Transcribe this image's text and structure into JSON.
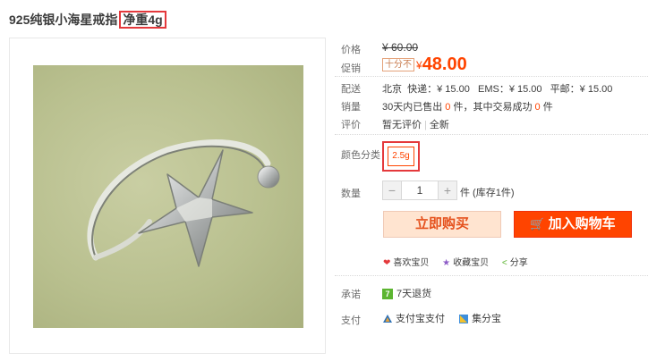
{
  "product": {
    "title": "925纯银小海星戒指",
    "title_highlight": "净重4g"
  },
  "price": {
    "label": "价格",
    "original": "¥ 60.00"
  },
  "promo": {
    "label": "促销",
    "tag": "十分不",
    "yen": "¥",
    "value": "48.00"
  },
  "delivery": {
    "label": "配送",
    "text": "北京  快递：¥ 15.00   EMS：¥ 15.00   平邮：¥ 15.00"
  },
  "sales": {
    "label": "销量",
    "text_a": "30天内已售出 ",
    "count_a": "0",
    "text_b": " 件，其中交易成功 ",
    "count_b": "0",
    "text_c": " 件"
  },
  "review": {
    "label": "评价",
    "none": "暂无评价",
    "divider": "|",
    "all": "全新"
  },
  "color": {
    "label": "颜色分类",
    "option": "2.5g"
  },
  "quantity": {
    "label": "数量",
    "minus": "−",
    "value": "1",
    "plus": "+",
    "unit": "件 (库存1件)"
  },
  "buttons": {
    "buy_now": "立即购买",
    "cart_icon": "🛒",
    "add_to_cart": "加入购物车"
  },
  "actions": {
    "like": "喜欢宝贝",
    "favorite": "收藏宝贝",
    "share": "分享"
  },
  "promise": {
    "label": "承诺",
    "badge": "7",
    "text": "7天退货"
  },
  "payment": {
    "label": "支付",
    "alipay": "支付宝支付",
    "jifen": "集分宝"
  },
  "colors": {
    "accent": "#ff4400",
    "highlight_border": "#e4393c",
    "buy_bg": "#ffe4d0",
    "green": "#5cb531"
  },
  "icons": [
    "heart-icon",
    "star-icon",
    "share-icon",
    "cart-icon",
    "alipay-icon",
    "jifenbao-icon"
  ]
}
